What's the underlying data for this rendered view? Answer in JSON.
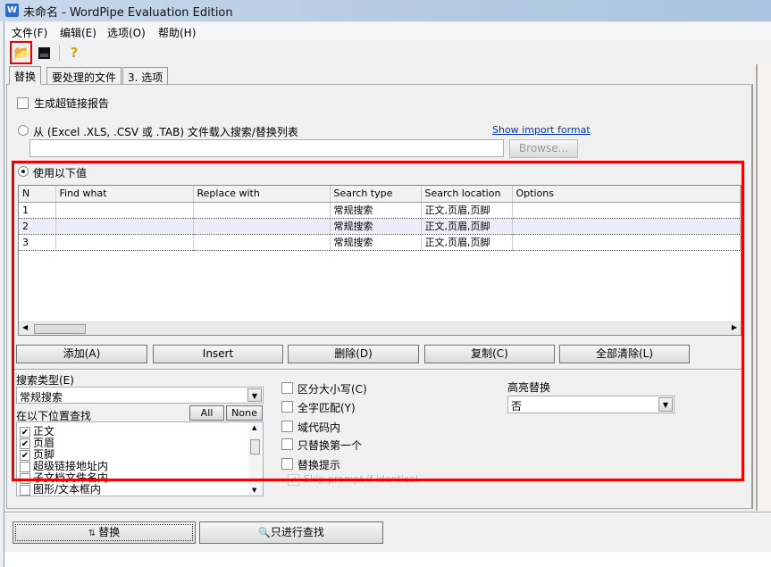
{
  "window": {
    "title": "未命名 - WordPipe Evaluation Edition",
    "icon": "W"
  },
  "menu": [
    "文件(F)",
    "编辑(E)",
    "选项(O)",
    "帮助(H)"
  ],
  "toolbar": {
    "open": "open-folder-icon",
    "save": "save-disk-icon",
    "help": "help-icon"
  },
  "tabs": [
    "替换",
    "要处理的文件",
    "3. 选项"
  ],
  "report_checkbox": {
    "label": "生成超链接报告",
    "checked": false
  },
  "import": {
    "label": "从 (Excel .XLS, .CSV 或 .TAB) 文件载入搜索/替换列表",
    "link": "Show import format",
    "path": "",
    "browse": "Browse..."
  },
  "use_values": {
    "label": "使用以下值",
    "selected": true
  },
  "grid": {
    "columns": [
      "N",
      "Find what",
      "Replace with",
      "Search type",
      "Search location",
      "Options"
    ],
    "rows": [
      [
        "1",
        "",
        "",
        "常规搜索",
        "正文,页眉,页脚",
        ""
      ],
      [
        "2",
        "",
        "",
        "常规搜索",
        "正文,页眉,页脚",
        ""
      ],
      [
        "3",
        "",
        "",
        "常规搜索",
        "正文,页眉,页脚",
        ""
      ]
    ]
  },
  "buttons": {
    "add": "添加(A)",
    "insert": "Insert",
    "delete": "删除(D)",
    "copy": "复制(C)",
    "clear": "全部清除(L)"
  },
  "search_type": {
    "label": "搜索类型(E)",
    "value": "常规搜索"
  },
  "locations": {
    "label": "在以下位置查找",
    "all": "All",
    "none": "None",
    "items": [
      {
        "label": "正文",
        "checked": true
      },
      {
        "label": "页眉",
        "checked": true
      },
      {
        "label": "页脚",
        "checked": true
      },
      {
        "label": "超级链接地址内",
        "checked": false
      },
      {
        "label": "子文档文件名内",
        "checked": false
      },
      {
        "label": "图形/文本框内",
        "checked": false
      }
    ]
  },
  "options": [
    {
      "label": "区分大小写(C)",
      "checked": false
    },
    {
      "label": "全字匹配(Y)",
      "checked": false
    },
    {
      "label": "域代码内",
      "checked": false
    },
    {
      "label": "只替换第一个",
      "checked": false
    },
    {
      "label": "替换提示",
      "checked": false
    }
  ],
  "skip_prompt": {
    "label": "Skip prompt if identical",
    "checked": true,
    "disabled": true
  },
  "highlight": {
    "label": "高亮替换",
    "value": "否"
  },
  "actions": {
    "replace": "替换",
    "find_only": "只进行查找"
  }
}
